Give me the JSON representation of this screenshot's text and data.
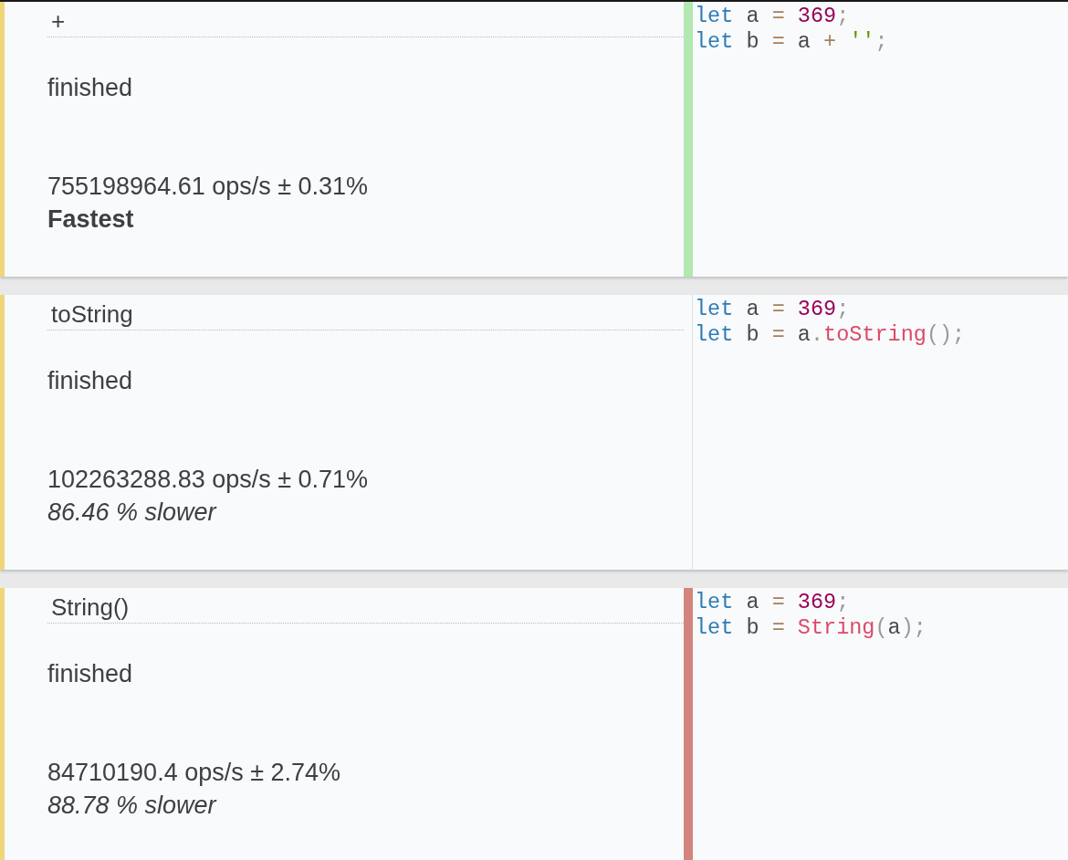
{
  "tests": [
    {
      "name": "+",
      "status": "finished",
      "result": "755198964.61 ops/s ± 0.31%",
      "verdict": "Fastest",
      "fastest": true,
      "color": "#b3e8b0",
      "code": [
        [
          {
            "kind": "keyword",
            "text": "let"
          },
          {
            "kind": "plain",
            "text": " a "
          },
          {
            "kind": "operator",
            "text": "="
          },
          {
            "kind": "number",
            "text": " 369"
          },
          {
            "kind": "punctuation",
            "text": ";"
          }
        ],
        [
          {
            "kind": "keyword",
            "text": "let"
          },
          {
            "kind": "plain",
            "text": " b "
          },
          {
            "kind": "operator",
            "text": "="
          },
          {
            "kind": "plain",
            "text": " a "
          },
          {
            "kind": "operator",
            "text": "+"
          },
          {
            "kind": "string",
            "text": " ''"
          },
          {
            "kind": "punctuation",
            "text": ";"
          }
        ]
      ]
    },
    {
      "name": "toString",
      "status": "finished",
      "result": "102263288.83 ops/s ± 0.71%",
      "verdict": "86.46 % slower",
      "fastest": false,
      "code": [
        [
          {
            "kind": "keyword",
            "text": "let"
          },
          {
            "kind": "plain",
            "text": " a "
          },
          {
            "kind": "operator",
            "text": "="
          },
          {
            "kind": "number",
            "text": " 369"
          },
          {
            "kind": "punctuation",
            "text": ";"
          }
        ],
        [
          {
            "kind": "keyword",
            "text": "let"
          },
          {
            "kind": "plain",
            "text": " b "
          },
          {
            "kind": "operator",
            "text": "="
          },
          {
            "kind": "plain",
            "text": " a"
          },
          {
            "kind": "punctuation",
            "text": "."
          },
          {
            "kind": "function",
            "text": "toString"
          },
          {
            "kind": "punctuation",
            "text": "();"
          }
        ]
      ]
    },
    {
      "name": "String()",
      "status": "finished",
      "result": "84710190.4 ops/s ± 2.74%",
      "verdict": "88.78 % slower",
      "fastest": false,
      "color": "#d4847f",
      "code": [
        [
          {
            "kind": "keyword",
            "text": "let"
          },
          {
            "kind": "plain",
            "text": " a "
          },
          {
            "kind": "operator",
            "text": "="
          },
          {
            "kind": "number",
            "text": " 369"
          },
          {
            "kind": "punctuation",
            "text": ";"
          }
        ],
        [
          {
            "kind": "keyword",
            "text": "let"
          },
          {
            "kind": "plain",
            "text": " b "
          },
          {
            "kind": "operator",
            "text": "="
          },
          {
            "kind": "function",
            "text": " String"
          },
          {
            "kind": "punctuation",
            "text": "("
          },
          {
            "kind": "plain",
            "text": "a"
          },
          {
            "kind": "punctuation",
            "text": ");"
          }
        ]
      ]
    }
  ]
}
